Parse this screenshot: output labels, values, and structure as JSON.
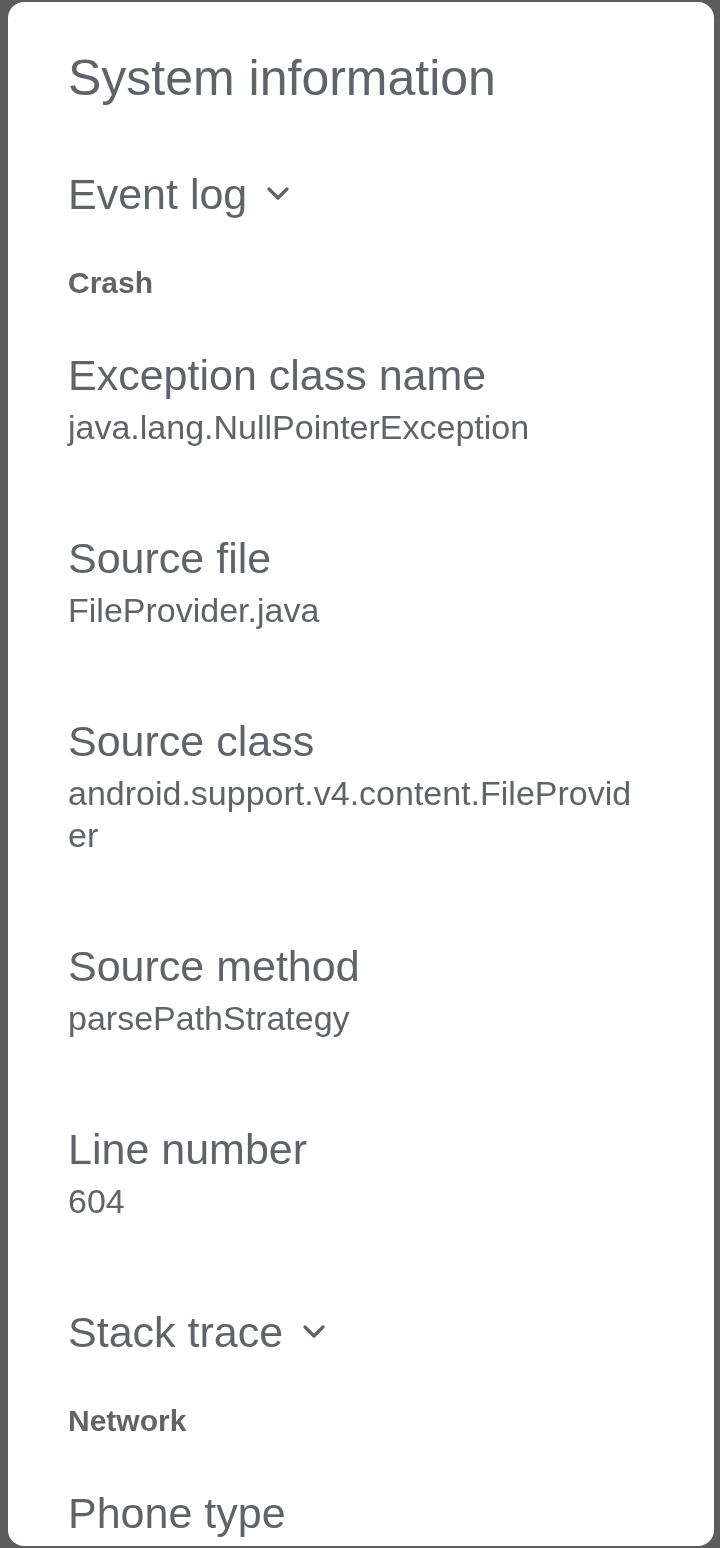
{
  "dialog": {
    "title": "System information"
  },
  "items": [
    {
      "kind": "toggle",
      "label": "Event log"
    },
    {
      "kind": "heading",
      "label": "Crash"
    },
    {
      "kind": "field",
      "label": "Exception class name",
      "value": "java.lang.NullPointerException"
    },
    {
      "kind": "field",
      "label": "Source file",
      "value": "FileProvider.java"
    },
    {
      "kind": "field",
      "label": "Source class",
      "value": "android.support.v4.content.FileProvider"
    },
    {
      "kind": "field",
      "label": "Source method",
      "value": "parsePathStrategy"
    },
    {
      "kind": "field",
      "label": "Line number",
      "value": "604"
    },
    {
      "kind": "toggle",
      "label": "Stack trace"
    },
    {
      "kind": "heading",
      "label": "Network"
    },
    {
      "kind": "field",
      "label": "Phone type"
    }
  ]
}
